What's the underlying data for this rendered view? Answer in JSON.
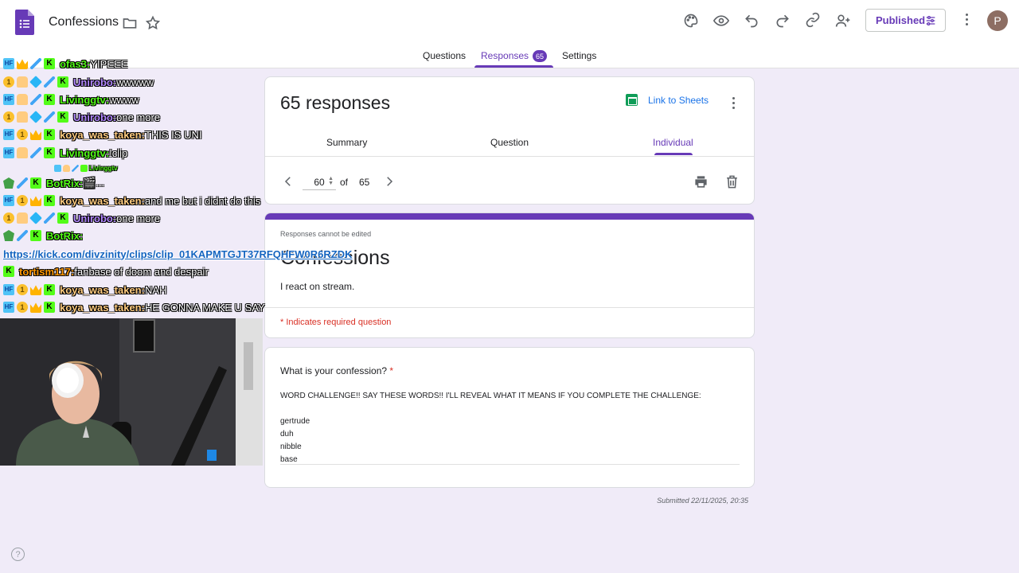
{
  "header": {
    "title": "Confessions",
    "published_label": "Published",
    "avatar_letter": "P"
  },
  "tabs": [
    {
      "label": "Questions"
    },
    {
      "label": "Responses",
      "count": "65"
    },
    {
      "label": "Settings"
    }
  ],
  "summary": {
    "title": "65 responses",
    "link_sheets": "Link to Sheets",
    "sub_tabs": [
      "Summary",
      "Question",
      "Individual"
    ],
    "current_page": "60",
    "of_label": "of",
    "total": "65"
  },
  "form": {
    "no_edit": "Responses cannot be edited",
    "title": "Confessions",
    "description": "I react on stream.",
    "required_note": "* Indicates required question"
  },
  "question": {
    "title": "What is your confession?",
    "required_star": "*",
    "answer_intro": "WORD CHALLENGE!! SAY THESE WORDS!! I'LL REVEAL WHAT IT MEANS IF YOU COMPLETE THE CHALLENGE:",
    "words": [
      "gertrude",
      "duh",
      "nibble",
      "base"
    ]
  },
  "submitted": "Submitted 22/11/2025, 20:35",
  "help": "?",
  "chat": [
    {
      "user": "ofas3:",
      "color": "#53fc18",
      "msg": " YIPEEE"
    },
    {
      "user": "Unirobo:",
      "color": "#b388ff",
      "msg": " wwwww"
    },
    {
      "user": "Livinggtv:",
      "color": "#53fc18",
      "msg": " wwww"
    },
    {
      "user": "Unirobo:",
      "color": "#b388ff",
      "msg": " one more"
    },
    {
      "user": "koya_was_taken:",
      "color": "#ffcc80",
      "msg": " THIS IS UNI"
    },
    {
      "user": "Livinggtv:",
      "color": "#53fc18",
      "msg": " !clip"
    },
    {
      "user": "BotRix:",
      "color": "#53fc18",
      "msg": " 🎬..."
    },
    {
      "user": "koya_was_taken:",
      "color": "#ffcc80",
      "msg": " and me but i didnt do this"
    },
    {
      "user": "Unirobo:",
      "color": "#b388ff",
      "msg": " one more"
    },
    {
      "user": "BotRix:",
      "color": "#53fc18",
      "msg": ""
    },
    {
      "user": "",
      "color": "#1565c0",
      "msg": "https://kick.com/divzinity/clips/clip_01KAPMTGJT37RFQHFW0R6RZDK"
    },
    {
      "user": "tortism117:",
      "color": "#ff9800",
      "msg": " fanbase of doom and despair"
    },
    {
      "user": "koya_was_taken:",
      "color": "#ffcc80",
      "msg": " NAH"
    },
    {
      "user": "koya_was_taken:",
      "color": "#ffcc80",
      "msg": " HE GONNA MAKE U SAY"
    }
  ],
  "mini_chat_user": "Livinggtv",
  "colors": {
    "accent": "#673ab7",
    "required": "#d93025",
    "link": "#1a73e8",
    "background": "#f0ebf8"
  }
}
